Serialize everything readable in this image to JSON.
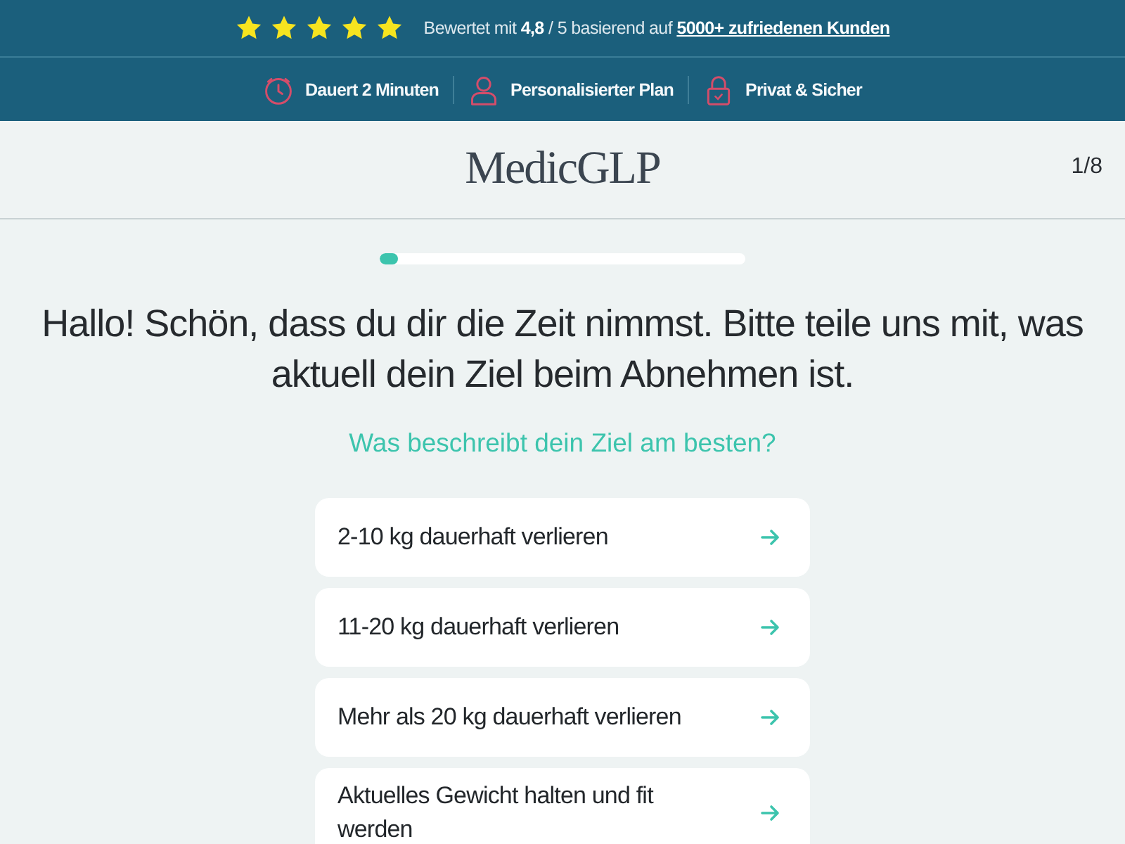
{
  "rating": {
    "stars": 5,
    "text": "Bewertet mit **4,8** / 5 basierend auf",
    "link": "5000+ zufriedenen Kunden"
  },
  "badges": [
    {
      "kind": "clock",
      "label": "Dauert 2 Minuten"
    },
    {
      "kind": "person",
      "label": "Personalisierter Plan"
    },
    {
      "kind": "lock",
      "label": "Privat & Sicher"
    }
  ],
  "header": {
    "logo": "MedicGLP",
    "step": "1/8"
  },
  "progress": {
    "level": 0.05
  },
  "question": {
    "title": "Hallo! Schön, dass du dir die Zeit nimmst. Bitte teile uns mit, was aktuell dein Ziel beim Abnehmen ist.",
    "subtitle": "Was beschreibt dein Ziel am besten?"
  },
  "options": [
    {
      "label": "2-10 kg dauerhaft verlieren"
    },
    {
      "label": "11-20 kg dauerhaft verlieren"
    },
    {
      "label": "Mehr als 20 kg dauerhaft verlieren"
    },
    {
      "label": "Aktuelles Gewicht halten und fit werden"
    }
  ]
}
